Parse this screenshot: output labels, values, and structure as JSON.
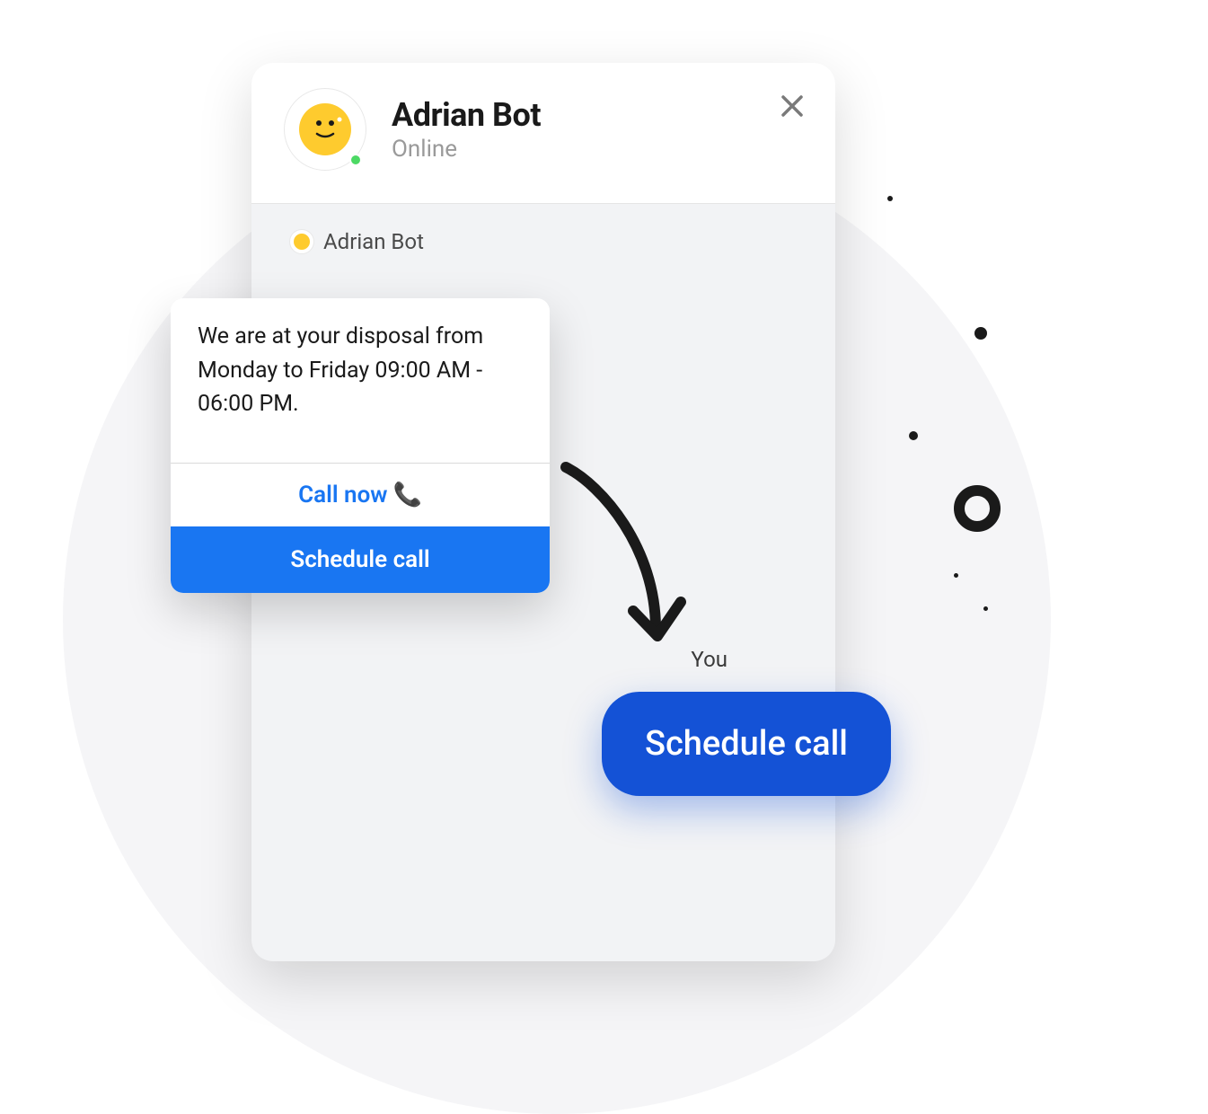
{
  "header": {
    "bot_name": "Adrian Bot",
    "status": "Online"
  },
  "conversation": {
    "sender_label": "Adrian Bot",
    "bot_message": "We are at your disposal from Monday to Friday 09:00 AM - 06:00 PM.",
    "call_now_label": "Call now",
    "schedule_btn_label": "Schedule call",
    "you_label": "You",
    "user_message": "Schedule call"
  },
  "colors": {
    "primary_blue": "#1976f2",
    "user_bubble": "#1452d6",
    "avatar_yellow": "#fecb2e",
    "online_green": "#4cd964"
  }
}
